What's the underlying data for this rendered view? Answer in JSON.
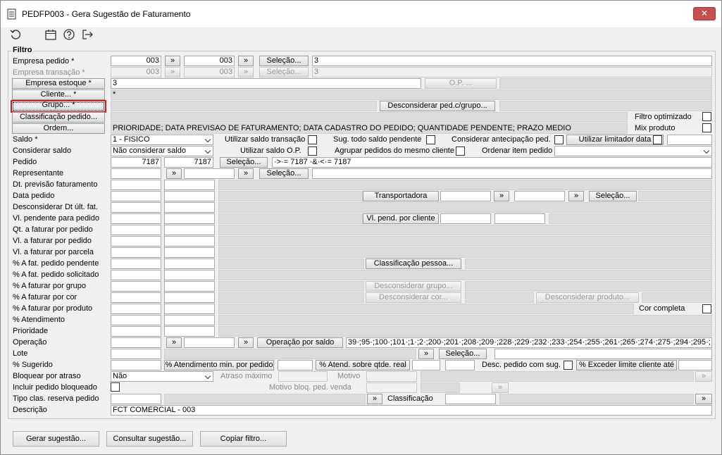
{
  "window": {
    "title": "PEDFP003 - Gera Sugestão de Faturamento",
    "close_glyph": "✕"
  },
  "colors": {
    "selection_border": "#e0141e",
    "close_button": "#c74f4f"
  },
  "icons": [
    "refresh-icon",
    "calendar-icon",
    "help-icon",
    "exit-icon"
  ],
  "filter_group": "Filtro",
  "left_labels": {
    "empresa_pedido": "Empresa pedido *",
    "empresa_transacao": "Empresa transação *",
    "saldo": "Saldo *",
    "considerar_saldo": "Considerar saldo",
    "pedido": "Pedido",
    "representante": "Representante",
    "dt_prev": "Dt. previsão faturamento",
    "data_pedido": "Data pedido",
    "desc_dt": "Desconsiderar Dt últ. fat.",
    "vl_pend": "Vl. pendente para pedido",
    "qt_fat": "Qt. a faturar por pedido",
    "vl_fat_ped": "Vl. a faturar por pedido",
    "vl_fat_parc": "Vl. a faturar por parcela",
    "pct_pend": "% A fat. pedido pendente",
    "pct_solic": "% A fat. pedido solicitado",
    "pct_grupo": "% A faturar por grupo",
    "pct_cor": "% A faturar por cor",
    "pct_prod": "% A faturar por produto",
    "pct_atend": "% Atendimento",
    "prioridade": "Prioridade",
    "operacao": "Operação",
    "lote": "Lote",
    "sugerido": "% Sugerido",
    "bloq_atraso": "Bloquear por atraso",
    "incluir_bloq": "Incluir pedido bloqueado",
    "tipo_clas": "Tipo clas. reserva pedido",
    "descricao": "Descrição"
  },
  "left_buttons": {
    "empresa_estoque": "Empresa estoque *",
    "cliente": "Cliente... *",
    "grupo": "Grupo... *",
    "classificacao": "Classificação pedido...",
    "ordem": "Ordem..."
  },
  "buttons": {
    "selecao": "Seleção...",
    "op": "O.P. ...",
    "desconsiderar_ped": "Desconsiderar ped.c/grupo...",
    "transportadora": "Transportadora",
    "vl_pend_cliente": "Vl. pend. por cliente",
    "classificacao_pessoa": "Classificação pessoa...",
    "desconsiderar_grupo": "Desconsiderar grupo...",
    "desconsiderar_cor": "Desconsiderar cor...",
    "desconsiderar_produto": "Desconsiderar produto...",
    "operacao_saldo": "Operação por saldo",
    "classificacao": "Classificação",
    "arrows": "»"
  },
  "values": {
    "emp_ped_1": "003",
    "emp_ped_2": "003",
    "emp_ped_sel": "3",
    "emp_tr_1": "003",
    "emp_tr_2": "003",
    "emp_tr_sel": "3",
    "emp_est": "3",
    "cliente": "*",
    "ordem": "PRIORIDADE; DATA PREVISAO DE FATURAMENTO; DATA CADASTRO DO PEDIDO; QUANTIDADE PENDENTE; PRAZO MEDIO",
    "saldo": "1 - FISICO",
    "considerar": "Não considerar saldo",
    "pedido_1": "7187",
    "pedido_2": "7187",
    "pedido_sel": "·>·= 7187 ·&·<·= 7187",
    "operacao_list": "39·;95·;100·;101·;1·;2·;200·;201·;208·;209·;228·;229·;232·;233·;254·;255·;261·;265·;274·;275·;294·;295·;",
    "bloq": "Não",
    "descricao": "FCT COMERCIAL - 003"
  },
  "inline_labels": {
    "filtro_optimizado": "Filtro optimizado",
    "mix_produto": "Mix produto",
    "utilizar_saldo_transacao": "Utilizar saldo transação",
    "sug_todo_saldo": "Sug. todo saldo pendente",
    "considerar_antecipacao": "Considerar antecipação ped.",
    "utilizar_limitador": "Utilizar limitador data",
    "utilizar_saldo_op": "Utilizar saldo O.P.",
    "agrupar_pedidos": "Agrupar pedidos do mesmo cliente",
    "ordenar_item": "Ordenar item pedido",
    "cor_completa": "Cor completa",
    "atend_min": "% Atendimento min. por pedido",
    "atend_qtde": "% Atend. sobre qtde. real",
    "desc_pedido_sug": "Desc. pedido com sug.",
    "exceder_limite": "% Exceder limite cliente até",
    "atraso_maximo": "Atraso máximo",
    "motivo": "Motivo",
    "motivo_bloq": "Motivo bloq. ped. venda"
  },
  "footer": {
    "gerar": "Gerar sugestão...",
    "consultar": "Consultar sugestão...",
    "copiar": "Copiar filtro..."
  }
}
